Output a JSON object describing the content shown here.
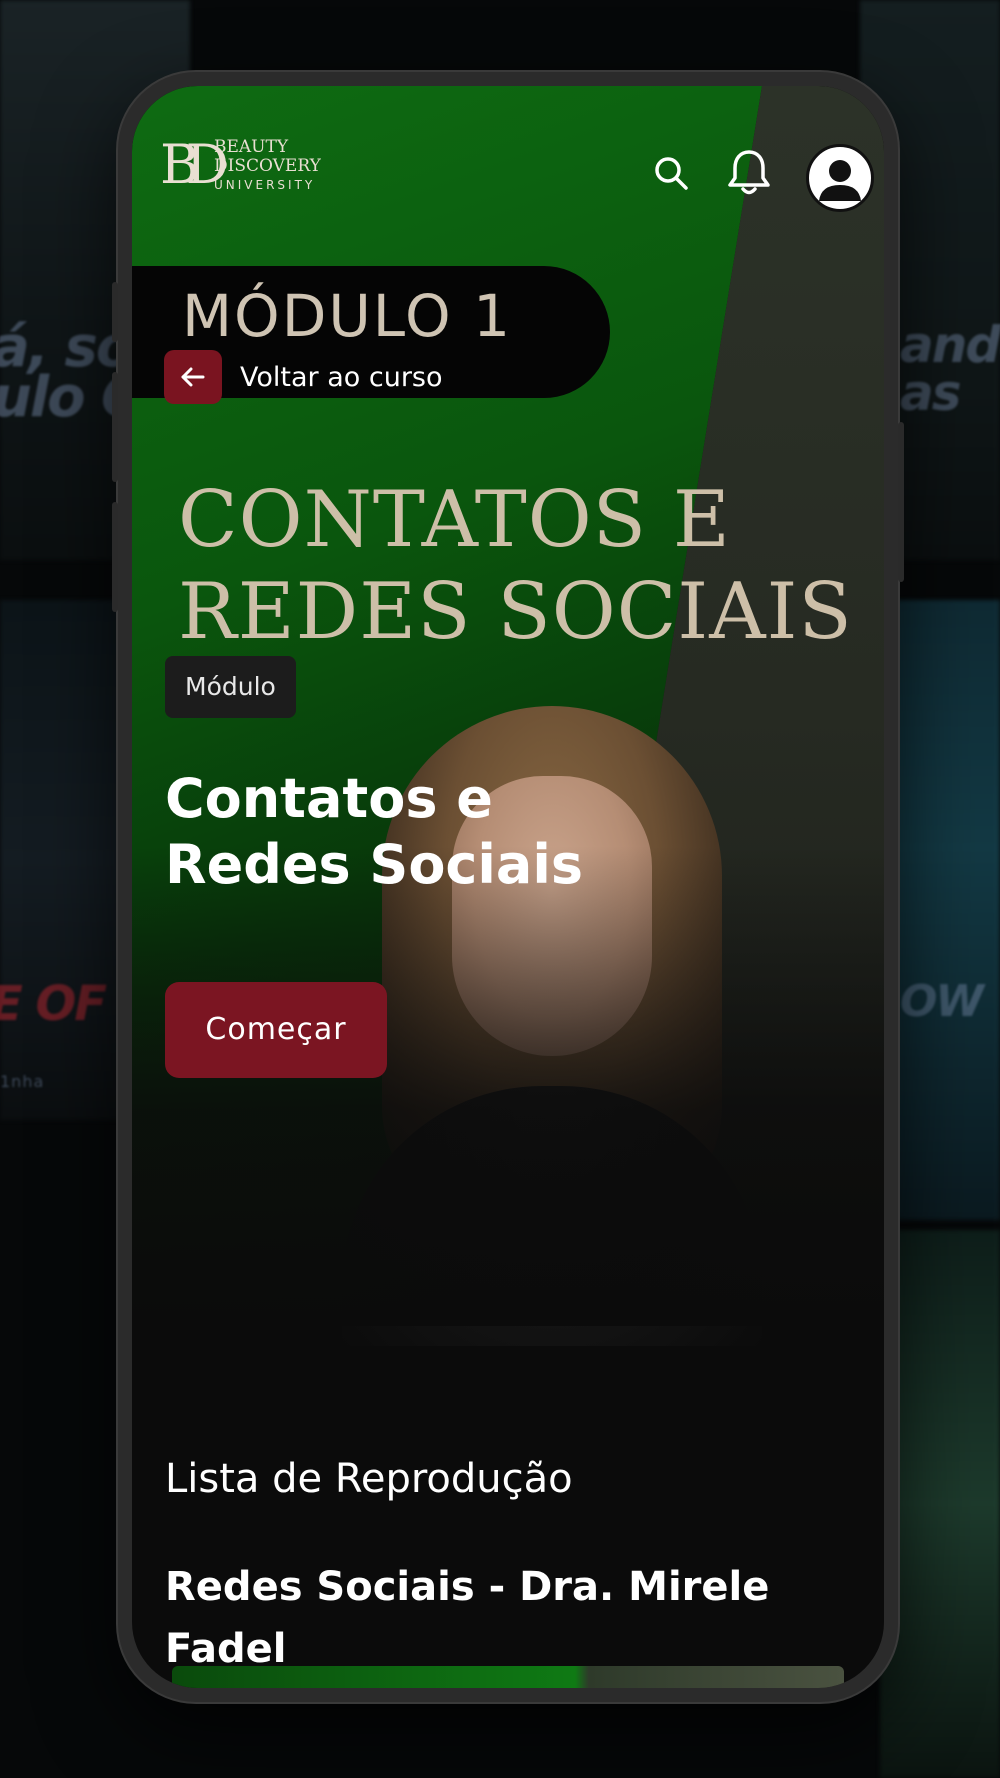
{
  "background": {
    "ghost_texts": [
      "á, sou",
      "ulo Co",
      "E OF",
      "1nha",
      "ando",
      "as",
      "OW"
    ]
  },
  "header": {
    "logo": {
      "mark": "BD",
      "line1": "BEAUTY",
      "line2": "DISCOVERY",
      "line3": "UNIVERSITY"
    },
    "icons": [
      "search-icon",
      "bell-icon",
      "user-avatar-icon"
    ]
  },
  "module": {
    "title": "MÓDULO 1",
    "back_label": "Voltar ao curso",
    "hero_title_lines": [
      "CONTATOS E",
      "REDES SOCIAIS"
    ]
  },
  "course": {
    "chip": "Módulo",
    "title_lines": [
      "Contatos e",
      "Redes Sociais"
    ],
    "start_label": "Começar"
  },
  "playlist": {
    "heading": "Lista de Reprodução",
    "items": [
      {
        "title": "Redes Sociais - Dra. Mirele Fadel"
      }
    ]
  },
  "colors": {
    "accent": "#7b1522",
    "hero_green": "#0e6b12",
    "title_beige": "#cdbfa8",
    "background": "#0b0b0b"
  }
}
